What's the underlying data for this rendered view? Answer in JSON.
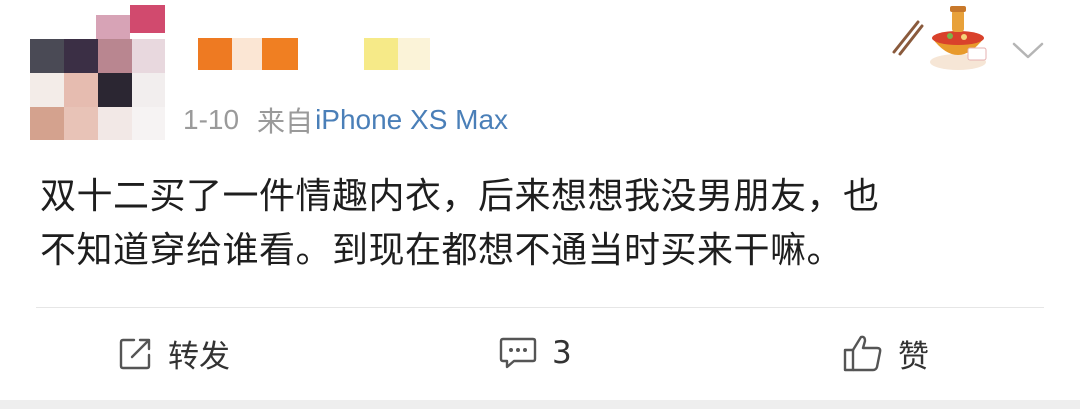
{
  "post": {
    "date": "1-10",
    "source_prefix": "来自",
    "device": "iPhone XS Max",
    "text_line1": "双十二买了一件情趣内衣，后来想想我没男朋友，也",
    "text_line2": "不知道穿给谁看。到现在都想不通当时买来干嘛。"
  },
  "actions": {
    "repost_label": "转发",
    "comment_count": "3",
    "like_label": "赞"
  },
  "icons": {
    "repost": "share-edit-icon",
    "comment": "comment-bubble-icon",
    "like": "thumbs-up-icon",
    "more": "chevron-down-icon",
    "decoration": "hotpot-decoration-icon"
  },
  "colors": {
    "meta_text": "#9a9a9a",
    "device_link": "#4a7fb8",
    "body_text": "#1e1e1e",
    "divider": "#e6e6e6"
  }
}
